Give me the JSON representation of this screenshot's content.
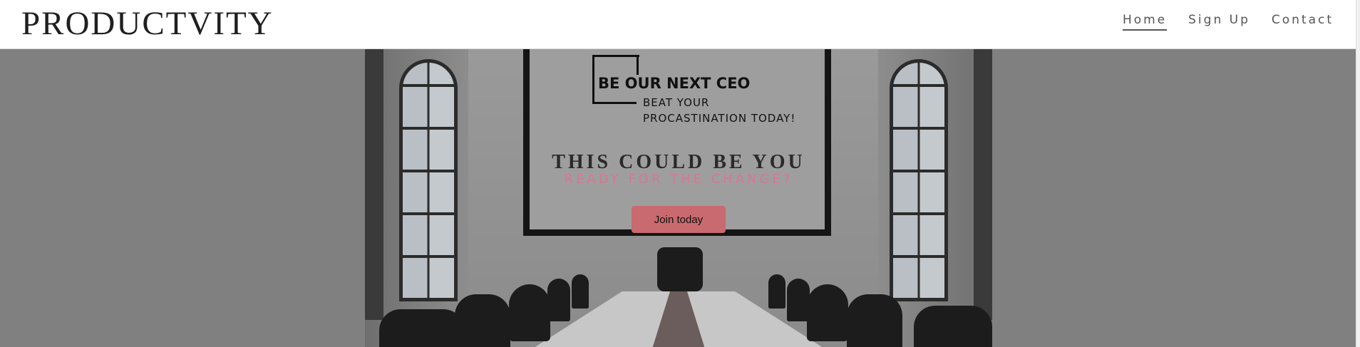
{
  "header": {
    "brand": "PRODUCTVITY",
    "nav": [
      {
        "label": "Home",
        "active": true
      },
      {
        "label": "Sign Up",
        "active": false
      },
      {
        "label": "Contact",
        "active": false
      }
    ]
  },
  "hero": {
    "board_title": "BE OUR NEXT CEO",
    "board_subtitle_line1": "BEAT YOUR",
    "board_subtitle_line2": "PROCASTINATION TODAY!",
    "title": "THIS COULD BE YOU",
    "subtitle": "READY FOR THE CHANGE?",
    "cta_label": "Join today"
  },
  "colors": {
    "overlay": "#808080",
    "accent_pink": "#d07a93",
    "button": "#c86a6f",
    "text_dark": "#1f1f1f"
  }
}
